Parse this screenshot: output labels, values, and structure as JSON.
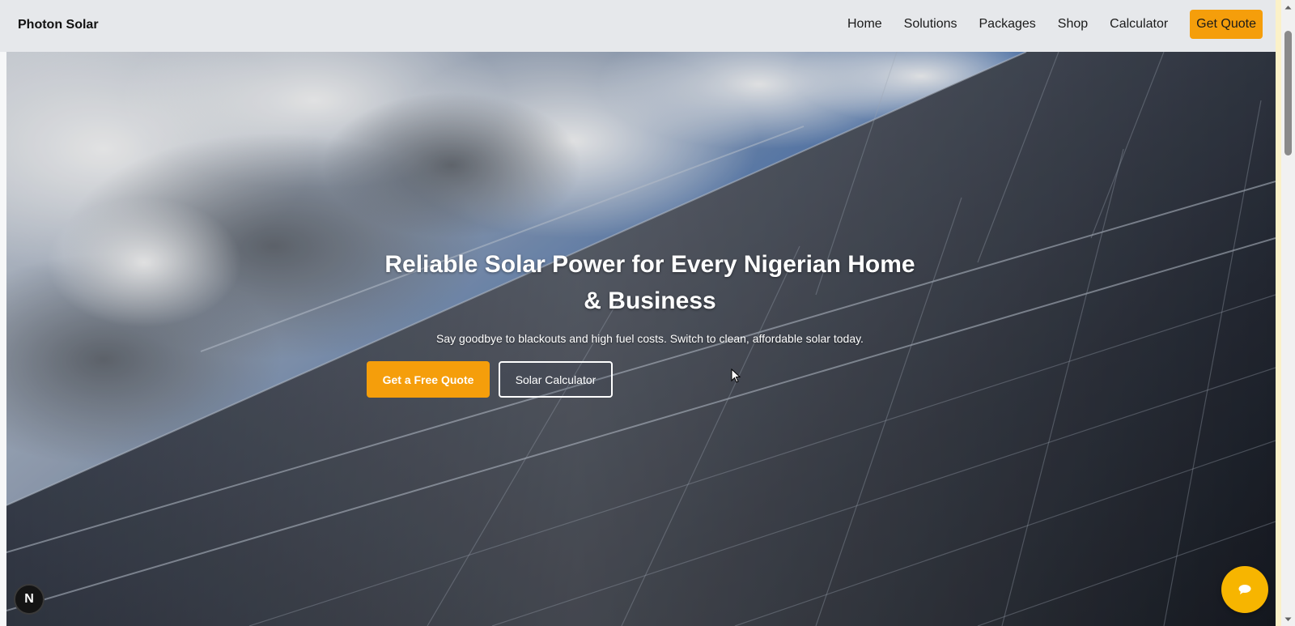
{
  "navbar": {
    "brand": "Photon Solar",
    "links": [
      "Home",
      "Solutions",
      "Packages",
      "Shop",
      "Calculator"
    ],
    "cta": "Get Quote"
  },
  "hero": {
    "title_line1": "Reliable Solar Power for Every Nigerian Home",
    "title_line2": "& Business",
    "subtitle": "Say goodbye to blackouts and high fuel costs. Switch to clean, affordable solar today.",
    "primary_button": "Get a Free Quote",
    "secondary_button": "Solar Calculator",
    "background": "solar panels under cloudy blue sky"
  },
  "widgets": {
    "devtools_badge": "N",
    "chat_icon": "chat-bubble-icon"
  },
  "colors": {
    "accent": "#f59e0b",
    "chat": "#f7b500",
    "navbar_bg": "#e6e8eb",
    "sky": "#4d77b4"
  }
}
